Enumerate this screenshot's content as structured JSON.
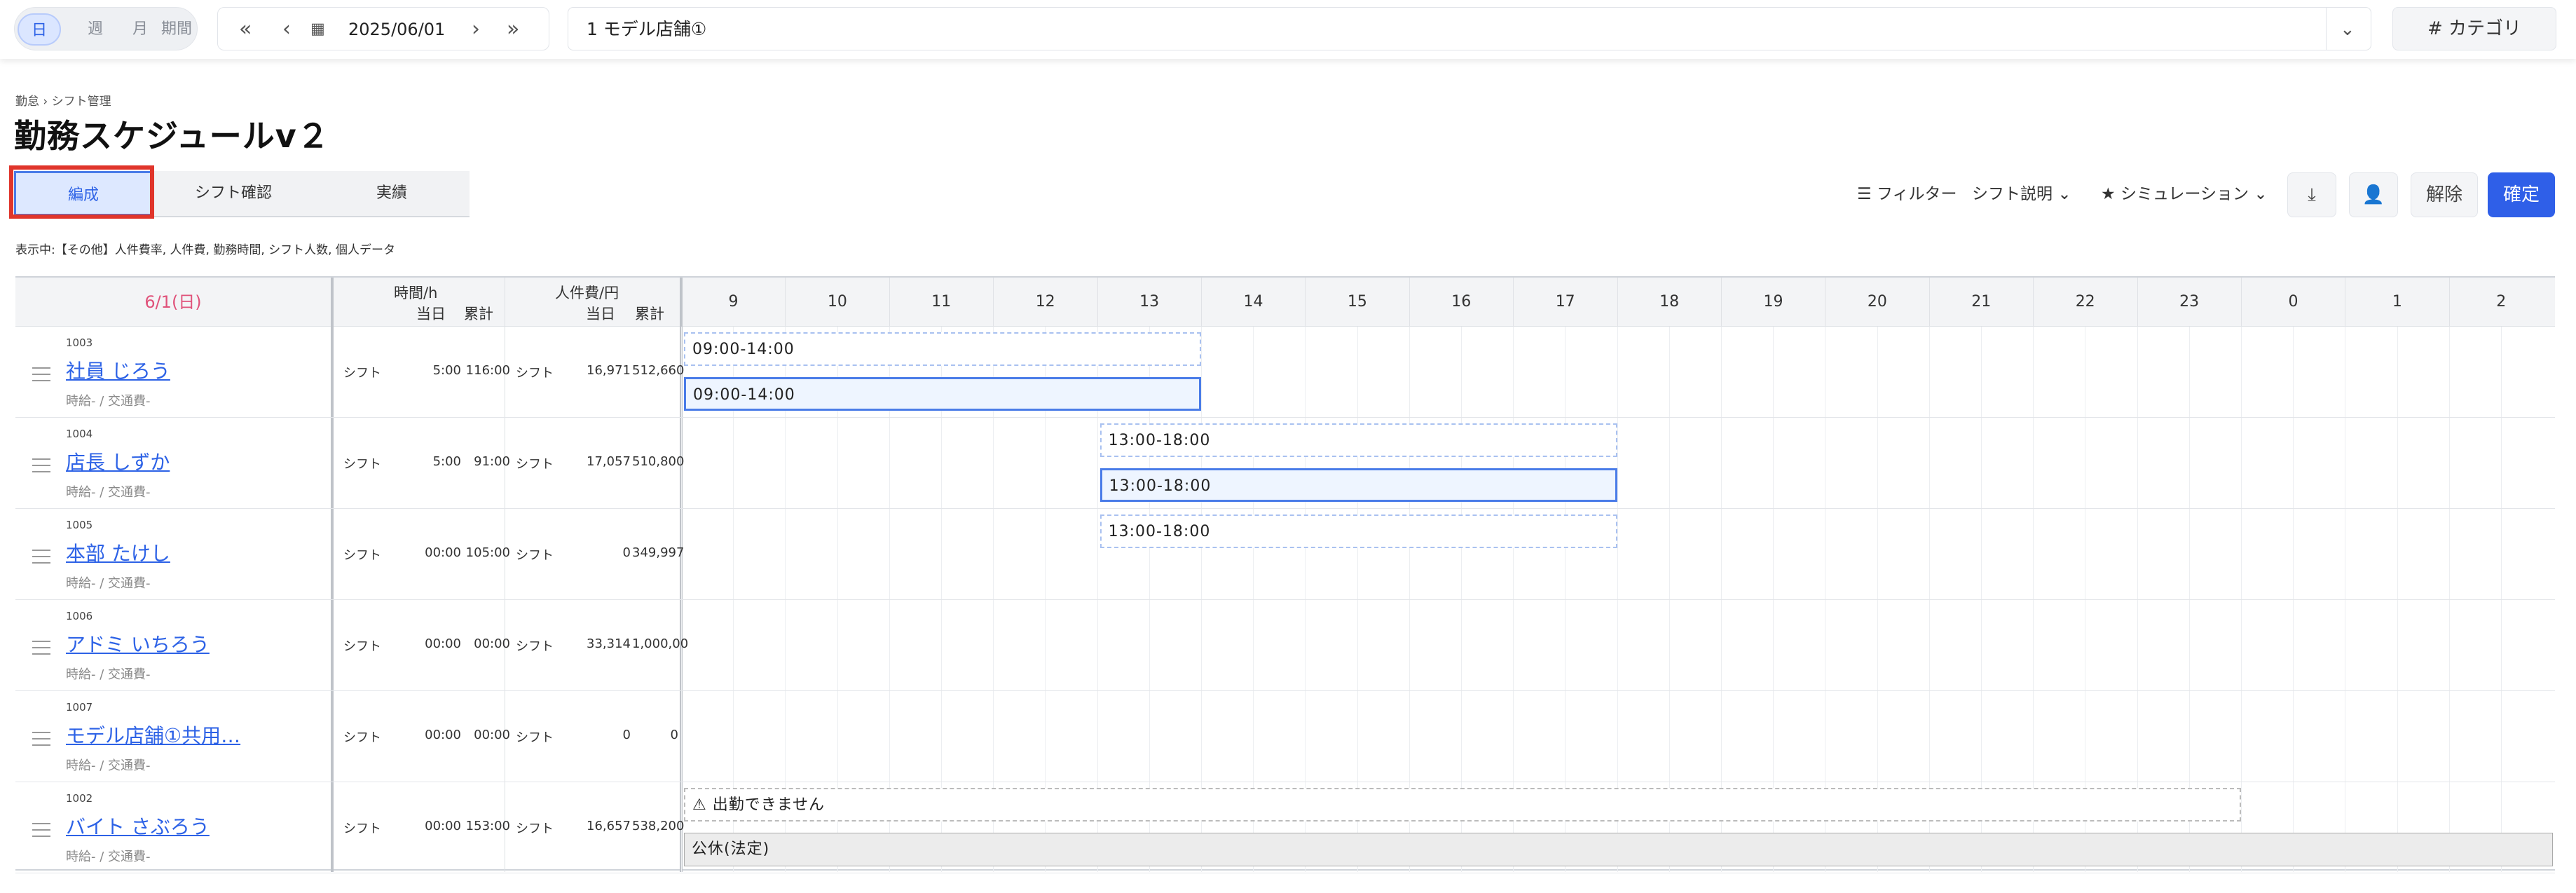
{
  "toolbar": {
    "view_modes": [
      "日",
      "週",
      "月",
      "期間"
    ],
    "date": "2025/06/01",
    "store": "1 モデル店舗①",
    "category_label": "カテゴリ"
  },
  "breadcrumb": {
    "parent": "勤怠",
    "sep": "›",
    "current": "シフト管理"
  },
  "page_title": "勤務スケジュールv２",
  "tabs": [
    "編成",
    "シフト確認",
    "実績"
  ],
  "actions": {
    "filter": "フィルター",
    "shift_desc": "シフト説明",
    "simulation": "シミュレーション",
    "release": "解除",
    "confirm": "確定"
  },
  "display_note": "表示中:【その他】人件費率, 人件費, 勤務時間, シフト人数, 個人データ",
  "grid": {
    "date_header": "6/1(日)",
    "time_header": "時間/h",
    "cost_header": "人件費/円",
    "day": "当日",
    "cumulative": "累計",
    "hours": [
      "9",
      "10",
      "11",
      "12",
      "13",
      "14",
      "15",
      "16",
      "17",
      "18",
      "19",
      "20",
      "21",
      "22",
      "23",
      "0",
      "1",
      "2"
    ]
  },
  "rows": [
    {
      "id": "1003",
      "name": "社員 じろう",
      "sub": "時給- / 交通費-",
      "type": "シフト",
      "time_day": "5:00",
      "time_cum": "116:00",
      "cost_type": "シフト",
      "cost_day": "16,971",
      "cost_cum": "512,660",
      "bars": [
        {
          "label": "09:00-14:00",
          "start": 9,
          "end": 14,
          "kind": "plan"
        },
        {
          "label": "09:00-14:00",
          "start": 9,
          "end": 14,
          "kind": "act"
        }
      ]
    },
    {
      "id": "1004",
      "name": "店長 しずか",
      "sub": "時給- / 交通費-",
      "type": "シフト",
      "time_day": "5:00",
      "time_cum": "91:00",
      "cost_type": "シフト",
      "cost_day": "17,057",
      "cost_cum": "510,800",
      "bars": [
        {
          "label": "13:00-18:00",
          "start": 13,
          "end": 18,
          "kind": "plan"
        },
        {
          "label": "13:00-18:00",
          "start": 13,
          "end": 18,
          "kind": "act"
        }
      ]
    },
    {
      "id": "1005",
      "name": "本部 たけし",
      "sub": "時給- / 交通費-",
      "type": "シフト",
      "time_day": "00:00",
      "time_cum": "105:00",
      "cost_type": "シフト",
      "cost_day": "0",
      "cost_cum": "349,997",
      "bars": [
        {
          "label": "13:00-18:00",
          "start": 13,
          "end": 18,
          "kind": "plan"
        }
      ]
    },
    {
      "id": "1006",
      "name": "アドミ いちろう",
      "sub": "時給- / 交通費-",
      "type": "シフト",
      "time_day": "00:00",
      "time_cum": "00:00",
      "cost_type": "シフト",
      "cost_day": "33,314",
      "cost_cum": "1,000,00",
      "bars": []
    },
    {
      "id": "1007",
      "name": "モデル店舗①共用…",
      "sub": "時給- / 交通費-",
      "type": "シフト",
      "time_day": "00:00",
      "time_cum": "00:00",
      "cost_type": "シフト",
      "cost_day": "0",
      "cost_cum": "0",
      "bars": []
    },
    {
      "id": "1002",
      "name": "バイト さぶろう",
      "sub": "時給- / 交通費-",
      "type": "シフト",
      "time_day": "00:00",
      "time_cum": "153:00",
      "cost_type": "シフト",
      "cost_day": "16,657",
      "cost_cum": "538,200",
      "bars": [
        {
          "label": "⚠ 出勤できません",
          "start": 9,
          "end": 24,
          "kind": "warn"
        },
        {
          "label": "公休(法定)",
          "start": 9,
          "end": 27,
          "kind": "hol"
        }
      ]
    }
  ]
}
